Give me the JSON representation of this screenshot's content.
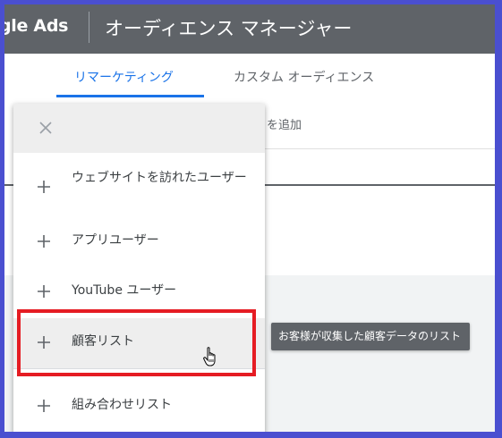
{
  "header": {
    "logo_text": "gle Ads",
    "title": "オーディエンス マネージャー"
  },
  "tabs": [
    {
      "label": "リマーケティング",
      "active": true
    },
    {
      "label": "カスタム オーディエンス",
      "active": false
    }
  ],
  "background": {
    "add_text": "を追加"
  },
  "menu": {
    "close_icon": "close-icon",
    "items": [
      {
        "label": "ウェブサイトを訪れたユーザー",
        "icon": "plus-icon"
      },
      {
        "label": "アプリユーザー",
        "icon": "plus-icon"
      },
      {
        "label": "YouTube ユーザー",
        "icon": "plus-icon"
      },
      {
        "label": "顧客リスト",
        "icon": "plus-icon",
        "hovered": true
      },
      {
        "label": "組み合わせリスト",
        "icon": "plus-icon"
      }
    ]
  },
  "tooltip": {
    "text": "お客様が収集した顧客データのリスト"
  },
  "colors": {
    "header_bg": "#5f6368",
    "accent": "#1a73e8",
    "highlight": "#e51c23",
    "border": "#4a4fd0"
  }
}
